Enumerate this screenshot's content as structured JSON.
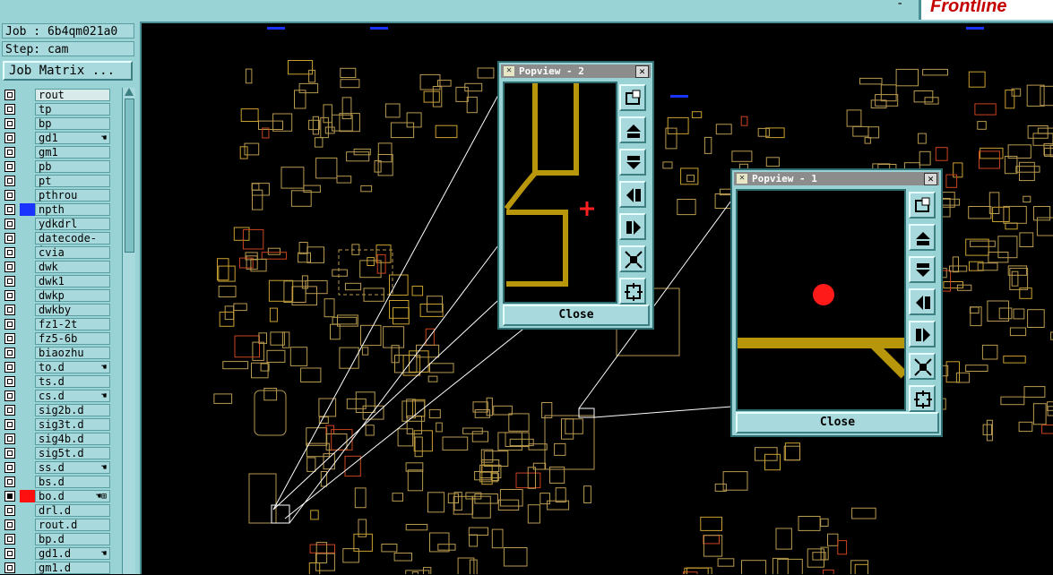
{
  "topbar": {
    "minimize": "-",
    "brand": "Frontline"
  },
  "job": {
    "label": "Job : ",
    "value": "6b4qm021a0"
  },
  "step": {
    "label": "Step: ",
    "value": "cam"
  },
  "job_matrix_label": "Job Matrix ...",
  "layers": [
    {
      "name": "rout",
      "checked": false,
      "color": "",
      "flag": ""
    },
    {
      "name": "tp",
      "checked": false,
      "color": "",
      "flag": ""
    },
    {
      "name": "bp",
      "checked": false,
      "color": "",
      "flag": ""
    },
    {
      "name": "gd1",
      "checked": false,
      "color": "",
      "flag": "☚"
    },
    {
      "name": "gm1",
      "checked": false,
      "color": "",
      "flag": ""
    },
    {
      "name": "pb",
      "checked": false,
      "color": "",
      "flag": ""
    },
    {
      "name": "pt",
      "checked": false,
      "color": "",
      "flag": ""
    },
    {
      "name": "pthrou",
      "checked": false,
      "color": "",
      "flag": ""
    },
    {
      "name": "npth",
      "checked": false,
      "color": "#1a33ff",
      "flag": ""
    },
    {
      "name": "ydkdrl",
      "checked": false,
      "color": "",
      "flag": ""
    },
    {
      "name": "datecode-to",
      "checked": false,
      "color": "",
      "flag": ""
    },
    {
      "name": "cvia",
      "checked": false,
      "color": "",
      "flag": ""
    },
    {
      "name": "dwk",
      "checked": false,
      "color": "",
      "flag": ""
    },
    {
      "name": "dwk1",
      "checked": false,
      "color": "",
      "flag": ""
    },
    {
      "name": "dwkp",
      "checked": false,
      "color": "",
      "flag": ""
    },
    {
      "name": "dwkby",
      "checked": false,
      "color": "",
      "flag": ""
    },
    {
      "name": "fz1-2t",
      "checked": false,
      "color": "",
      "flag": ""
    },
    {
      "name": "fz5-6b",
      "checked": false,
      "color": "",
      "flag": ""
    },
    {
      "name": "biaozhu",
      "checked": false,
      "color": "",
      "flag": ""
    },
    {
      "name": "to.d",
      "checked": false,
      "color": "",
      "flag": "☚"
    },
    {
      "name": "ts.d",
      "checked": false,
      "color": "",
      "flag": ""
    },
    {
      "name": "cs.d",
      "checked": false,
      "color": "",
      "flag": "☚"
    },
    {
      "name": "sig2b.d",
      "checked": false,
      "color": "",
      "flag": ""
    },
    {
      "name": "sig3t.d",
      "checked": false,
      "color": "",
      "flag": ""
    },
    {
      "name": "sig4b.d",
      "checked": false,
      "color": "",
      "flag": ""
    },
    {
      "name": "sig5t.d",
      "checked": false,
      "color": "",
      "flag": ""
    },
    {
      "name": "ss.d",
      "checked": false,
      "color": "",
      "flag": "☚"
    },
    {
      "name": "bs.d",
      "checked": false,
      "color": "",
      "flag": ""
    },
    {
      "name": "bo.d",
      "checked": true,
      "color": "#ff1010",
      "flag": "☚⊞"
    },
    {
      "name": "drl.d",
      "checked": false,
      "color": "",
      "flag": ""
    },
    {
      "name": "rout.d",
      "checked": false,
      "color": "",
      "flag": ""
    },
    {
      "name": "bp.d",
      "checked": false,
      "color": "",
      "flag": ""
    },
    {
      "name": "gd1.d",
      "checked": false,
      "color": "",
      "flag": "☚"
    },
    {
      "name": "gm1.d",
      "checked": false,
      "color": "",
      "flag": ""
    }
  ],
  "popview2": {
    "title": "Popview - 2",
    "close_label": "Close"
  },
  "popview1": {
    "title": "Popview - 1",
    "close_label": "Close"
  },
  "nav_icons": [
    "zoom-fit-icon",
    "pan-up-icon",
    "pan-down-icon",
    "pan-left-icon",
    "pan-right-icon",
    "zoom-out-icon",
    "zoom-in-icon"
  ],
  "colors": {
    "panel": "#9ad3d6",
    "copper": "#b8960c",
    "outline": "#c8a85a",
    "cursor": "#ff0000"
  }
}
